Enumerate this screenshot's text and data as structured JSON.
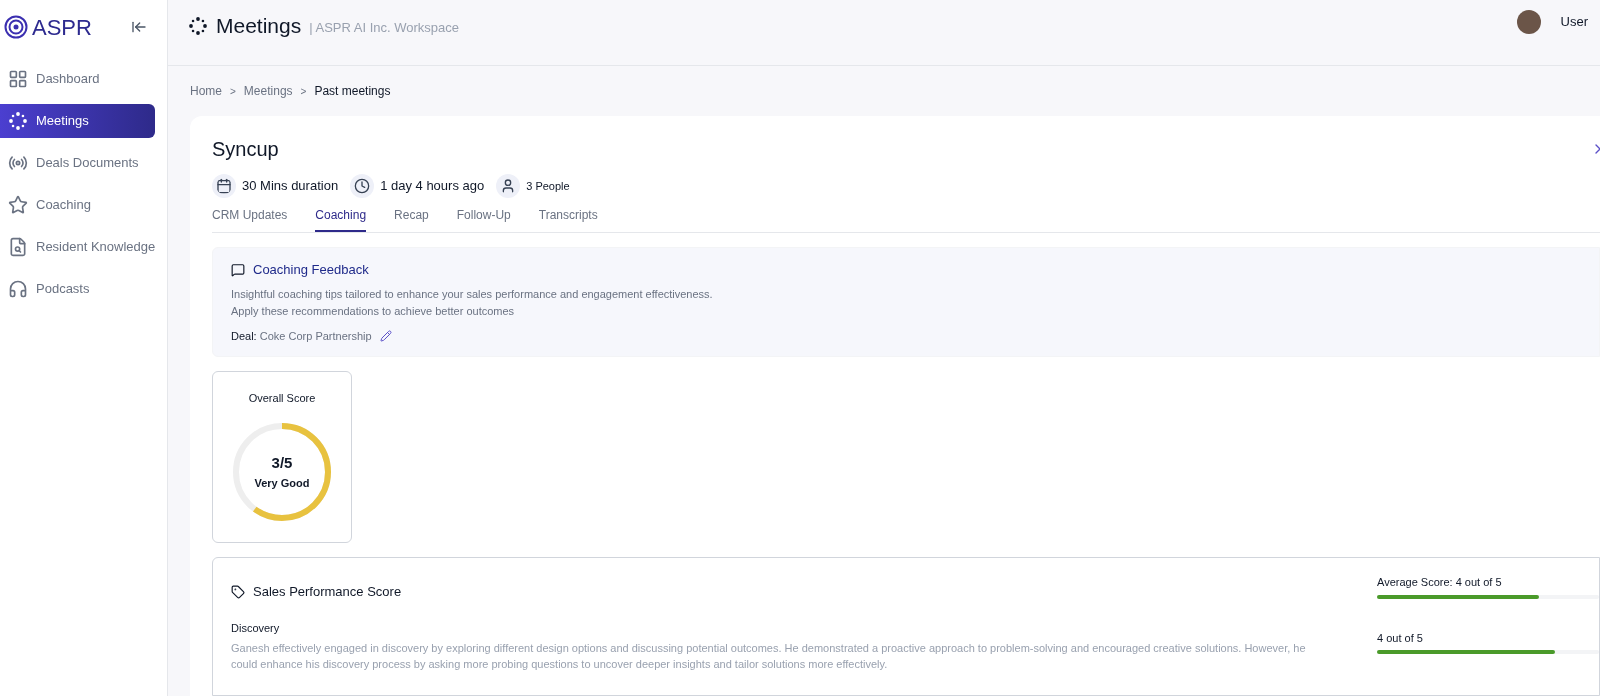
{
  "brand": "ASPR",
  "sidebar": {
    "items": [
      {
        "label": "Dashboard",
        "kind": "grid",
        "selected": false
      },
      {
        "label": "Meetings",
        "kind": "spark",
        "selected": true
      },
      {
        "label": "Deals Documents",
        "kind": "signal",
        "selected": false
      },
      {
        "label": "Coaching",
        "kind": "star",
        "selected": false
      },
      {
        "label": "Resident Knowledge",
        "kind": "doc",
        "selected": false
      },
      {
        "label": "Podcasts",
        "kind": "headphones",
        "selected": false
      }
    ]
  },
  "header": {
    "title": "Meetings",
    "subtitle": "| ASPR AI Inc. Workspace",
    "user": "User"
  },
  "breadcrumb": [
    {
      "label": "Home",
      "current": false
    },
    {
      "label": "Meetings",
      "current": false
    },
    {
      "label": "Past meetings",
      "current": true
    }
  ],
  "breadcrumb_separator": ">",
  "meeting": {
    "title": "Syncup",
    "meta": [
      {
        "kind": "calendar",
        "text": "30 Mins duration"
      },
      {
        "kind": "clock",
        "text": "1 day 4 hours ago"
      },
      {
        "kind": "person",
        "text": "3 People"
      }
    ]
  },
  "tabs": [
    {
      "label": "CRM Updates",
      "selected": false
    },
    {
      "label": "Coaching",
      "selected": true
    },
    {
      "label": "Recap",
      "selected": false
    },
    {
      "label": "Follow-Up",
      "selected": false
    },
    {
      "label": "Transcripts",
      "selected": false
    }
  ],
  "feedback": {
    "title": "Coaching Feedback",
    "lines": [
      "Insightful coaching tips tailored to enhance your sales performance and engagement effectiveness.",
      "Apply these recommendations to achieve better outcomes"
    ],
    "deal": "**Deal:** Coke Corp Partnership"
  },
  "overall": {
    "title": "Overall Score",
    "score": "3/5",
    "rating": "Very Good",
    "level": 0.6
  },
  "sales": {
    "title": "Sales Performance Score",
    "average": "Average Score: 4 out of 5",
    "level": 0.73,
    "sections": [
      {
        "name": "Discovery",
        "text": "Ganesh effectively engaged in discovery by exploring different design options and discussing potential outcomes. He demonstrated a proactive approach to problem-solving and encouraged creative solutions. However, he could enhance his discovery process by asking more probing questions to uncover deeper insights and tailor solutions more effectively.",
        "score": "4 out of 5",
        "level": 0.8
      }
    ]
  }
}
